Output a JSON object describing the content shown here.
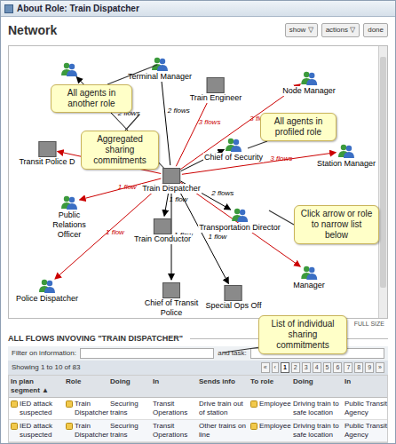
{
  "window": {
    "title": "About Role: Train Dispatcher"
  },
  "header": {
    "title": "Network",
    "buttons": [
      {
        "label": "show ▽"
      },
      {
        "label": "actions ▽"
      },
      {
        "label": "done"
      }
    ]
  },
  "network": {
    "center": {
      "label": "Train Dispatcher",
      "kind": "photo"
    },
    "nodes": [
      {
        "kind": "group",
        "flows": "2 flows",
        "color": "#000000"
      },
      {
        "label": "Terminal Manager",
        "kind": "group",
        "flows": "2 flows",
        "color": "#000000"
      },
      {
        "label": "Train Engineer",
        "kind": "photo",
        "flows": "3 flows",
        "color": "#cc0000"
      },
      {
        "label": "Node Manager",
        "kind": "group",
        "flows": "3 flows",
        "color": "#cc0000"
      },
      {
        "label": "Transit Police D",
        "kind": "photo",
        "flows": "2 flows",
        "color": "#cc0000"
      },
      {
        "label": "Chief of Security",
        "kind": "group",
        "flows": "1 flow",
        "color": "#000000"
      },
      {
        "label": "Station Manager",
        "kind": "group",
        "flows": "3 flows",
        "color": "#cc0000"
      },
      {
        "label": "Public Relations Officer",
        "kind": "group",
        "flows": "1 flow",
        "color": "#cc0000"
      },
      {
        "label": "Train Conductor",
        "kind": "photo",
        "flows": "1 flow",
        "color": "#000000"
      },
      {
        "label": "Transportation Director",
        "kind": "group",
        "flows": "2 flows",
        "color": "#000000"
      },
      {
        "label": "Police Dispatcher",
        "kind": "group",
        "flows": "1 flow",
        "color": "#cc0000"
      },
      {
        "label": "Chief of Transit Police",
        "kind": "photo",
        "flows": "1 flow",
        "color": "#000000"
      },
      {
        "label": "Special Ops Off",
        "kind": "photo",
        "flows": "1 flow",
        "color": "#000000"
      },
      {
        "label": "Manager",
        "kind": "group",
        "flows": "2 flows",
        "color": "#cc0000"
      }
    ],
    "full_size": "FULL SIZE"
  },
  "callouts": [
    "All agents in another role",
    "Aggregated sharing commitments",
    "All agents in profiled role",
    "Click arrow or role to narrow list below",
    "List of individual sharing commitments"
  ],
  "flows": {
    "title": "ALL FLOWS INVOVING \"TRAIN DISPATCHER\"",
    "filter_info_label": "Filter on information:",
    "filter_task_label": "and task:",
    "showing": "Showing 1 to 10 of 83",
    "pages": [
      {
        "label": "«",
        "selected": false
      },
      {
        "label": "‹",
        "selected": false
      },
      {
        "label": "1",
        "selected": true
      },
      {
        "label": "2",
        "selected": false
      },
      {
        "label": "3",
        "selected": false
      },
      {
        "label": "4",
        "selected": false
      },
      {
        "label": "5",
        "selected": false
      },
      {
        "label": "6",
        "selected": false
      },
      {
        "label": "7",
        "selected": false
      },
      {
        "label": "8",
        "selected": false
      },
      {
        "label": "9",
        "selected": false
      },
      {
        "label": "»",
        "selected": false
      }
    ],
    "columns": [
      "In plan segment ▲",
      "Role",
      "Doing",
      "In",
      "Sends info",
      "To role",
      "Doing",
      "In"
    ],
    "rows": [
      [
        "IED attack suspected",
        "Train Dispatcher",
        "Securing trains",
        "Transit Operations",
        "Drive train out of station",
        "Employee",
        "Driving train to safe location",
        "Public Transit Agency"
      ],
      [
        "IED attack suspected",
        "Train Dispatcher",
        "Securing trains",
        "Transit Operations",
        "Other trains on line",
        "Employee",
        "Driving train to safe location",
        "Public Transit Agency"
      ]
    ]
  }
}
